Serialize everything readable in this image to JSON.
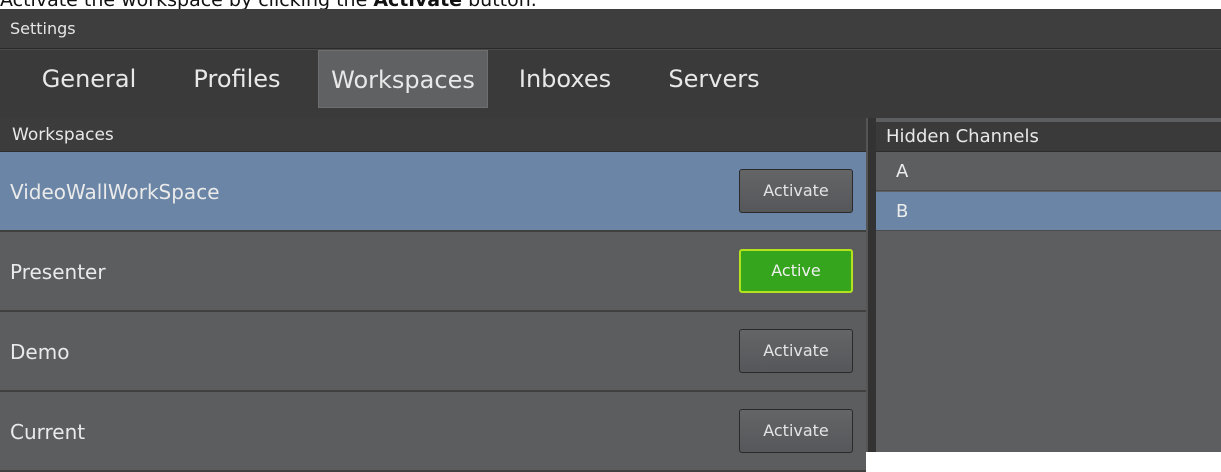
{
  "caption": {
    "prefix": "Activate the workspace by clicking the ",
    "emphasis": "Activate",
    "suffix": " button."
  },
  "window": {
    "title": "Settings"
  },
  "tabs": [
    {
      "label": "General",
      "active": false
    },
    {
      "label": "Profiles",
      "active": false
    },
    {
      "label": "Workspaces",
      "active": true
    },
    {
      "label": "Inboxes",
      "active": false
    },
    {
      "label": "Servers",
      "active": false
    }
  ],
  "workspaces": {
    "header": "Workspaces",
    "rows": [
      {
        "name": "VideoWallWorkSpace",
        "button": "Activate",
        "selected": true,
        "active": false
      },
      {
        "name": "Presenter",
        "button": "Active",
        "selected": false,
        "active": true
      },
      {
        "name": "Demo",
        "button": "Activate",
        "selected": false,
        "active": false
      },
      {
        "name": "Current",
        "button": "Activate",
        "selected": false,
        "active": false
      }
    ]
  },
  "hidden_channels": {
    "header": "Hidden Channels",
    "items": [
      {
        "label": "A",
        "selected": false
      },
      {
        "label": "B",
        "selected": true
      }
    ]
  },
  "colors": {
    "selection": "#6a85a5",
    "active_button": "#35a51e",
    "active_button_border": "#b5e21c"
  }
}
